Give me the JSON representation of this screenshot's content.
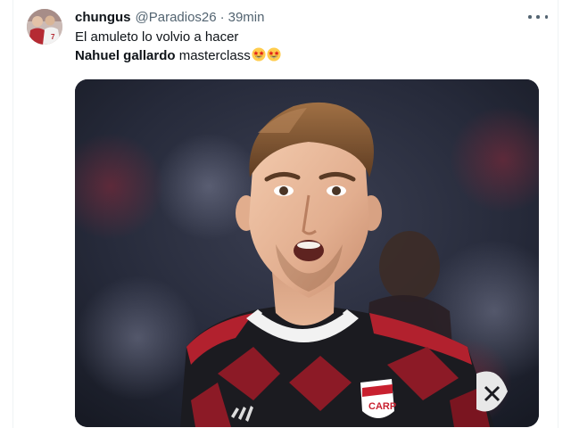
{
  "tweet": {
    "display_name": "chungus",
    "handle": "@Paradios26",
    "separator": "·",
    "time": "39min",
    "text_line1": "El amuleto lo volvio a hacer",
    "text_bold": "Nahuel gallardo",
    "text_rest": " masterclass",
    "emojis": [
      "star-struck-emoji",
      "star-struck-emoji"
    ]
  },
  "icons": {
    "more": "more-horizontal-icon",
    "avatar": "profile-avatar"
  },
  "colors": {
    "text_primary": "#0f1419",
    "text_secondary": "#536471",
    "border": "#eff3f4"
  }
}
